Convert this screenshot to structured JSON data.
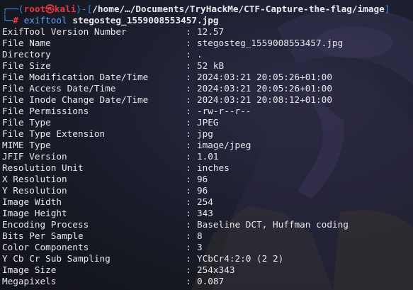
{
  "prompt": {
    "frame_open": "┌──(",
    "user_host": "root㉿kali",
    "frame_mid": ")-[",
    "path": "/home/…/Documents/TryHackMe/CTF-Capture-the-flag/image",
    "frame_close": "]",
    "frame_cmd": "└─",
    "hash": "#",
    "command": "exiftool",
    "argument": "stegosteg_1559008553457.jpg"
  },
  "separator": ":",
  "rows": [
    {
      "key": "ExifTool Version Number",
      "value": "12.57"
    },
    {
      "key": "File Name",
      "value": "stegosteg_1559008553457.jpg"
    },
    {
      "key": "Directory",
      "value": "."
    },
    {
      "key": "File Size",
      "value": "52 kB"
    },
    {
      "key": "File Modification Date/Time",
      "value": "2024:03:21 20:05:26+01:00"
    },
    {
      "key": "File Access Date/Time",
      "value": "2024:03:21 20:05:26+01:00"
    },
    {
      "key": "File Inode Change Date/Time",
      "value": "2024:03:21 20:08:12+01:00"
    },
    {
      "key": "File Permissions",
      "value": "-rw-r--r--"
    },
    {
      "key": "File Type",
      "value": "JPEG"
    },
    {
      "key": "File Type Extension",
      "value": "jpg"
    },
    {
      "key": "MIME Type",
      "value": "image/jpeg"
    },
    {
      "key": "JFIF Version",
      "value": "1.01"
    },
    {
      "key": "Resolution Unit",
      "value": "inches"
    },
    {
      "key": "X Resolution",
      "value": "96"
    },
    {
      "key": "Y Resolution",
      "value": "96"
    },
    {
      "key": "Image Width",
      "value": "254"
    },
    {
      "key": "Image Height",
      "value": "343"
    },
    {
      "key": "Encoding Process",
      "value": "Baseline DCT, Huffman coding"
    },
    {
      "key": "Bits Per Sample",
      "value": "8"
    },
    {
      "key": "Color Components",
      "value": "3"
    },
    {
      "key": "Y Cb Cr Sub Sampling",
      "value": "YCbCr4:2:0 (2 2)"
    },
    {
      "key": "Image Size",
      "value": "254x343"
    },
    {
      "key": "Megapixels",
      "value": "0.087"
    }
  ],
  "colors": {
    "background": "#161821",
    "text": "#e8e8ee",
    "prompt_frame": "#3c8fe6",
    "prompt_user": "#e3383e",
    "command": "#5aa0ff"
  }
}
